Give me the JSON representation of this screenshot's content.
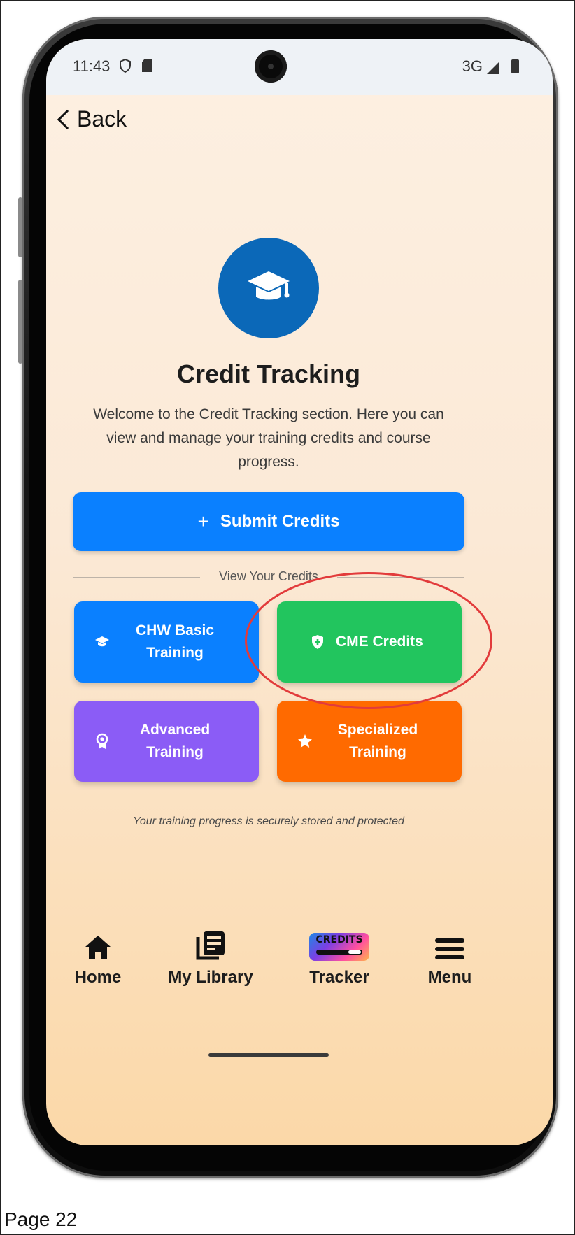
{
  "status_bar": {
    "time": "11:43",
    "network": "3G"
  },
  "header": {
    "back_label": "Back"
  },
  "main": {
    "title": "Credit Tracking",
    "description": "Welcome to the Credit Tracking section. Here you can view and manage your training credits and course progress.",
    "submit_button": {
      "icon": "+",
      "label": "Submit Credits",
      "color": "#0a80ff"
    },
    "divider_label": "View Your Credits",
    "tiles": [
      {
        "line1": "CHW Basic",
        "line2": "Training",
        "icon": "graduation-cap-icon",
        "color": "#0a80ff"
      },
      {
        "line1": "CME Credits",
        "line2": "",
        "icon": "shield-plus-icon",
        "color": "#22c55e"
      },
      {
        "line1": "Advanced",
        "line2": "Training",
        "icon": "award-icon",
        "color": "#8b5cf6"
      },
      {
        "line1": "Specialized",
        "line2": "Training",
        "icon": "star-icon",
        "color": "#ff6a00"
      }
    ],
    "footer_note": "Your training progress is securely stored and protected"
  },
  "bottom_nav": {
    "items": [
      {
        "label": "Home",
        "icon": "home-icon"
      },
      {
        "label": "My Library",
        "icon": "library-icon"
      },
      {
        "label": "Tracker",
        "icon": "credits-icon",
        "badge_text": "CREDITS"
      },
      {
        "label": "Menu",
        "icon": "hamburger-icon"
      }
    ]
  },
  "page_footer": {
    "page_number": "Page 22"
  },
  "colors": {
    "hero_circle": "#0b68b8",
    "highlight": "#e23b3b"
  }
}
